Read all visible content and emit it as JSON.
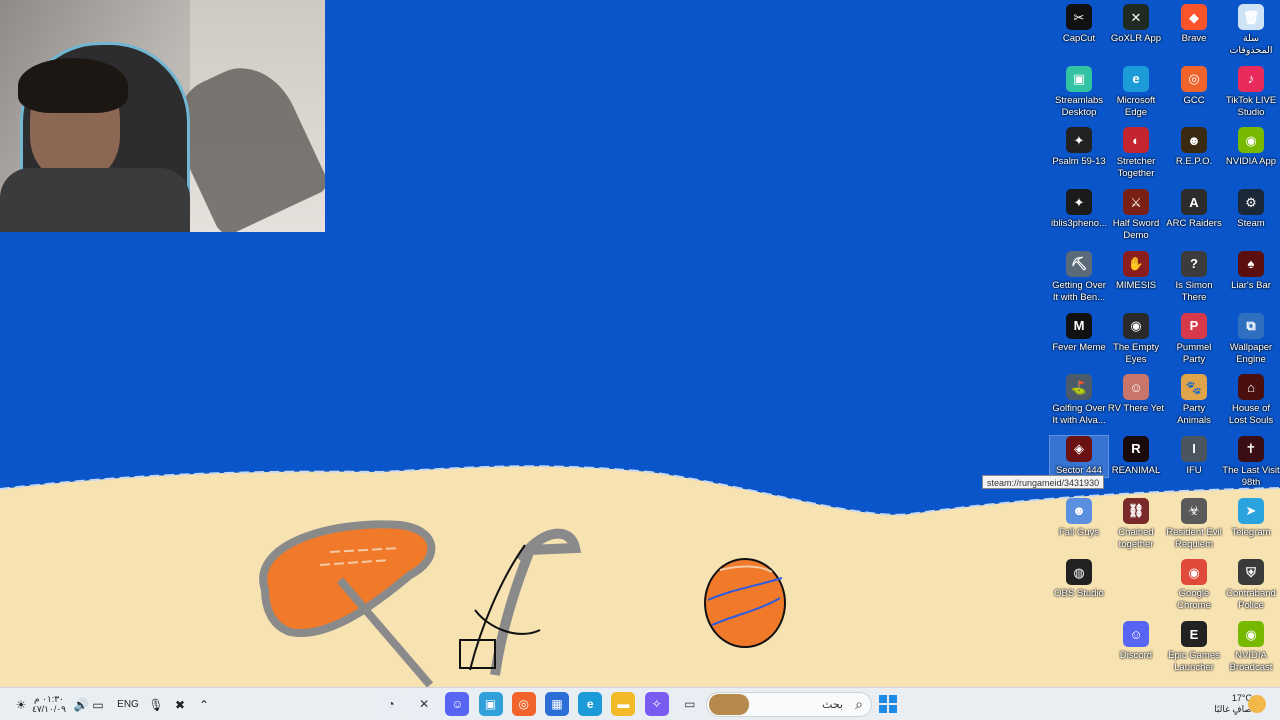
{
  "desktop": {
    "icons": [
      {
        "label": "CapCut",
        "color": "#111111",
        "glyph": "✂",
        "col": 0,
        "row": 0
      },
      {
        "label": "GoXLR App",
        "color": "#1f2b22",
        "glyph": "✕",
        "col": 1,
        "row": 0
      },
      {
        "label": "Brave",
        "color": "#fb542b",
        "glyph": "◆",
        "col": 2,
        "row": 0
      },
      {
        "label": "سلة المحذوفات",
        "color": "#cfe3f7",
        "glyph": "🗑",
        "col": 3,
        "row": 0
      },
      {
        "label": "Streamlabs Desktop",
        "color": "#31c3a2",
        "glyph": "▣",
        "col": 0,
        "row": 1
      },
      {
        "label": "Microsoft Edge",
        "color": "#1b9bd8",
        "glyph": "e",
        "col": 1,
        "row": 1
      },
      {
        "label": "GCC",
        "color": "#f0642b",
        "glyph": "◎",
        "col": 2,
        "row": 1
      },
      {
        "label": "TikTok LIVE Studio",
        "color": "#e92b5c",
        "glyph": "♪",
        "col": 3,
        "row": 1
      },
      {
        "label": "Psalm 59-13",
        "color": "#222222",
        "glyph": "✦",
        "col": 0,
        "row": 2
      },
      {
        "label": "Stretcher Together",
        "color": "#c4242d",
        "glyph": "◐",
        "col": 1,
        "row": 2
      },
      {
        "label": "R.E.P.O.",
        "color": "#3a2a12",
        "glyph": "☻",
        "col": 2,
        "row": 2
      },
      {
        "label": "NVIDIA App",
        "color": "#76b900",
        "glyph": "◉",
        "col": 3,
        "row": 2
      },
      {
        "label": "iblis3pheno...",
        "color": "#1b1b1b",
        "glyph": "✦",
        "col": 0,
        "row": 3
      },
      {
        "label": "Half Sword Demo",
        "color": "#7a1f14",
        "glyph": "⚔",
        "col": 1,
        "row": 3
      },
      {
        "label": "ARC Raiders",
        "color": "#2c2c2c",
        "glyph": "A",
        "col": 2,
        "row": 3
      },
      {
        "label": "Steam",
        "color": "#1b2838",
        "glyph": "⚙",
        "col": 3,
        "row": 3
      },
      {
        "label": "Getting Over It with Ben...",
        "color": "#5a6a78",
        "glyph": "⛏",
        "col": 0,
        "row": 4
      },
      {
        "label": "MIMESIS",
        "color": "#8a1d1d",
        "glyph": "✋",
        "col": 1,
        "row": 4
      },
      {
        "label": "Is Simon There",
        "color": "#3b3b3b",
        "glyph": "?",
        "col": 2,
        "row": 4
      },
      {
        "label": "Liar's Bar",
        "color": "#5b0f0f",
        "glyph": "♠",
        "col": 3,
        "row": 4
      },
      {
        "label": "Fever Meme",
        "color": "#111111",
        "glyph": "M",
        "col": 0,
        "row": 5
      },
      {
        "label": "The Empty Eyes",
        "color": "#2a2a2a",
        "glyph": "◉",
        "col": 1,
        "row": 5
      },
      {
        "label": "Pummel Party",
        "color": "#d63a4a",
        "glyph": "P",
        "col": 2,
        "row": 5
      },
      {
        "label": "Wallpaper Engine",
        "color": "#2f6fbf",
        "glyph": "⧉",
        "col": 3,
        "row": 5
      },
      {
        "label": "Golfing Over It with Alva...",
        "color": "#4b5b6b",
        "glyph": "⛳",
        "col": 0,
        "row": 6
      },
      {
        "label": "RV There Yet",
        "color": "#c9756a",
        "glyph": "☺",
        "col": 1,
        "row": 6
      },
      {
        "label": "Party Animals",
        "color": "#e0a44a",
        "glyph": "🐾",
        "col": 2,
        "row": 6
      },
      {
        "label": "House of Lost Souls",
        "color": "#4a1010",
        "glyph": "⌂",
        "col": 3,
        "row": 6
      },
      {
        "label": "Sector 444",
        "color": "#6a1010",
        "glyph": "◈",
        "col": 0,
        "row": 7,
        "hover": true
      },
      {
        "label": "REANIMAL",
        "color": "#1a0a0a",
        "glyph": "R",
        "col": 1,
        "row": 7
      },
      {
        "label": "IFU",
        "color": "#4a5560",
        "glyph": "I",
        "col": 2,
        "row": 7
      },
      {
        "label": "The Last Visit 98th",
        "color": "#3a0e12",
        "glyph": "✝",
        "col": 3,
        "row": 7
      },
      {
        "label": "Fall Guys",
        "color": "#5b8fe0",
        "glyph": "☻",
        "col": 0,
        "row": 8
      },
      {
        "label": "Chained together",
        "color": "#7a2a2a",
        "glyph": "⛓",
        "col": 1,
        "row": 8
      },
      {
        "label": "Resident Evil Requiem",
        "color": "#5a5a5a",
        "glyph": "☣",
        "col": 2,
        "row": 8
      },
      {
        "label": "Telegram",
        "color": "#2aa3df",
        "glyph": "➤",
        "col": 3,
        "row": 8
      },
      {
        "label": "OBS Studio",
        "color": "#222222",
        "glyph": "◍",
        "col": 0,
        "row": 9
      },
      {
        "label": "Google Chrome",
        "color": "#e04a3a",
        "glyph": "◉",
        "col": 2,
        "row": 9
      },
      {
        "label": "Contraband Police",
        "color": "#3a3a3a",
        "glyph": "⛨",
        "col": 3,
        "row": 9
      },
      {
        "label": "Discord",
        "color": "#5865f2",
        "glyph": "☺",
        "col": 1,
        "row": 10
      },
      {
        "label": "Epic Games Launcher",
        "color": "#222222",
        "glyph": "E",
        "col": 2,
        "row": 10
      },
      {
        "label": "NVIDIA Broadcast",
        "color": "#76b900",
        "glyph": "◉",
        "col": 3,
        "row": 10
      }
    ],
    "tooltip": "steam://rungameid/3431930"
  },
  "taskbar": {
    "clock_time": "٠١:٣٠ م",
    "clock_date": "٤٧/١٠/٠٩",
    "language": "ENG",
    "search_placeholder": "بحث",
    "weather_temp": "17°C",
    "weather_desc": "صافٍ غالبًا",
    "pinned": [
      {
        "name": "snipping-tool",
        "color": "#e8eef4",
        "glyph": "◔"
      },
      {
        "name": "goxlr",
        "color": "#e8eef4",
        "glyph": "✕"
      },
      {
        "name": "discord",
        "color": "#5865f2",
        "glyph": "☺"
      },
      {
        "name": "streamlabs",
        "color": "#31a0d8",
        "glyph": "▣"
      },
      {
        "name": "gcc",
        "color": "#f0642b",
        "glyph": "◎"
      },
      {
        "name": "store",
        "color": "#2b6fd6",
        "glyph": "▦"
      },
      {
        "name": "edge",
        "color": "#1b9bd8",
        "glyph": "e"
      },
      {
        "name": "file-explorer",
        "color": "#f2b928",
        "glyph": "▬"
      },
      {
        "name": "copilot",
        "color": "#7a5cf0",
        "glyph": "✧"
      },
      {
        "name": "task-view",
        "color": "#e8eef4",
        "glyph": "▭"
      }
    ]
  },
  "colors": {
    "sky": "#0a55c9",
    "sand": "#f7e2b2",
    "umbrella": "#f07a2a",
    "outline": "#8a8a8a"
  }
}
